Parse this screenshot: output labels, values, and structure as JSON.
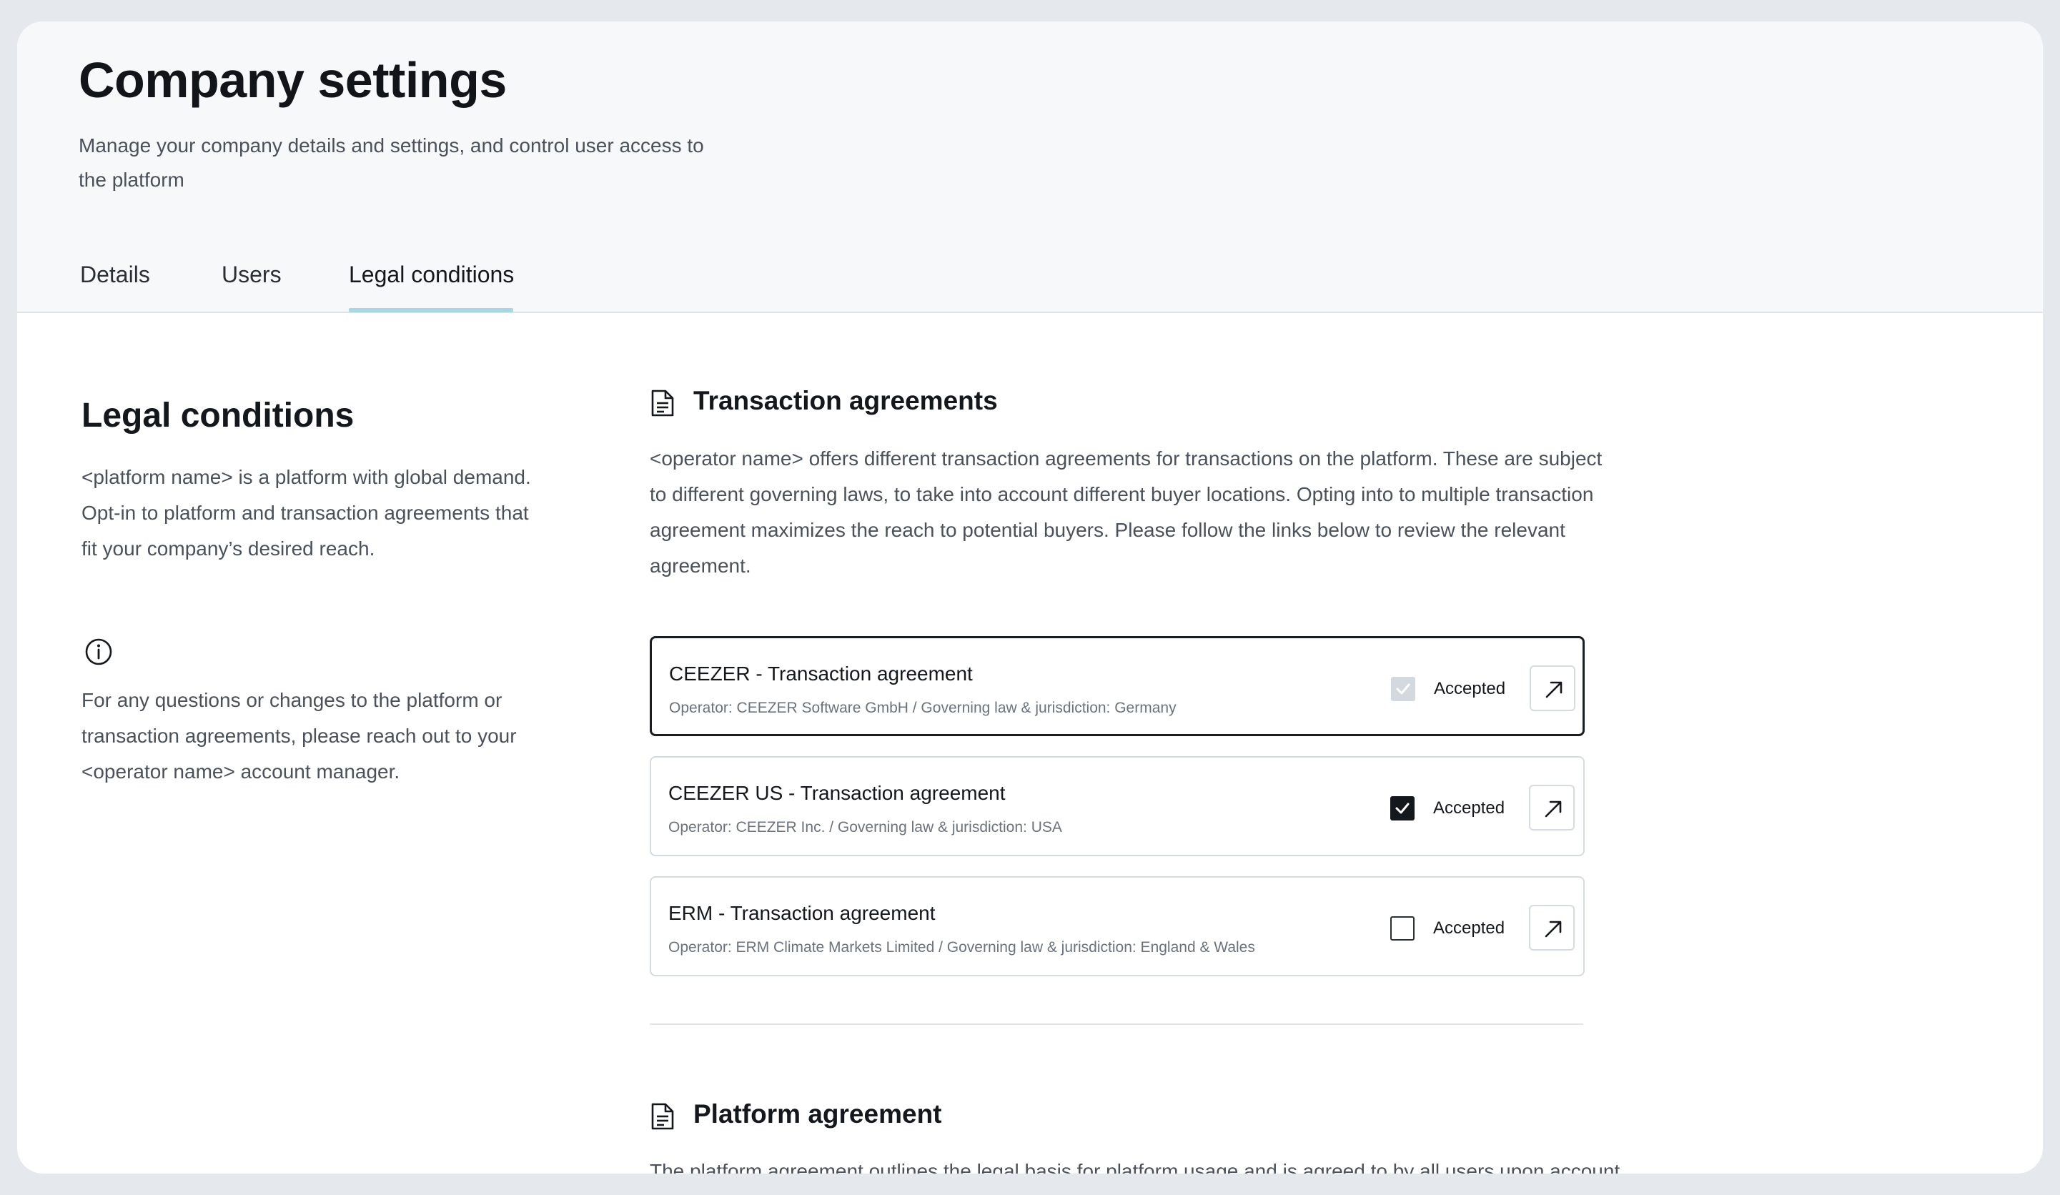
{
  "header": {
    "title": "Company settings",
    "subtitle": "Manage your company details and settings, and control user access to the platform"
  },
  "tabs": [
    {
      "label": "Details"
    },
    {
      "label": "Users"
    },
    {
      "label": "Legal conditions",
      "active": true
    }
  ],
  "sidebar": {
    "heading": "Legal conditions",
    "intro": "<platform name> is a platform with global demand. Opt-in to platform and transaction agreements that fit your company’s desired reach.",
    "info_icon": "info-circle-icon",
    "info_text": "For any questions or changes to the platform or transaction agreements, please reach out to your <operator name> account manager."
  },
  "transaction_section": {
    "icon": "document-icon",
    "heading": "Transaction agreements",
    "description": "<operator name> offers different transaction agreements for transactions on the platform. These are subject to different governing laws, to take into account different buyer locations. Opting into to multiple transaction agreement maximizes the reach to potential buyers.  Please follow the links below to review the relevant agreement.",
    "agreements": [
      {
        "title": "CEEZER - Transaction agreement",
        "subtitle": "Operator: CEEZER Software GmbH / Governing law & jurisdiction: Germany",
        "accepted_label": "Accepted",
        "state": "checked-disabled",
        "open_icon": "arrow-up-right-icon"
      },
      {
        "title": "CEEZER US - Transaction agreement",
        "subtitle": "Operator: CEEZER Inc. / Governing law & jurisdiction: USA",
        "accepted_label": "Accepted",
        "state": "checked",
        "open_icon": "arrow-up-right-icon"
      },
      {
        "title": "ERM - Transaction agreement",
        "subtitle": "Operator: ERM Climate Markets Limited / Governing law & jurisdiction: England & Wales",
        "accepted_label": "Accepted",
        "state": "unchecked",
        "open_icon": "arrow-up-right-icon"
      }
    ]
  },
  "platform_section": {
    "icon": "document-icon",
    "heading": "Platform agreement",
    "description": "The platform agreement outlines the legal basis for platform usage and is agreed to by all users upon account"
  },
  "colors": {
    "background": "#e5e8ec",
    "header_bg": "#f6f8fa",
    "tab_indicator": "#a9d6e4",
    "text_primary": "#14171c",
    "text_secondary": "#4a515b"
  }
}
